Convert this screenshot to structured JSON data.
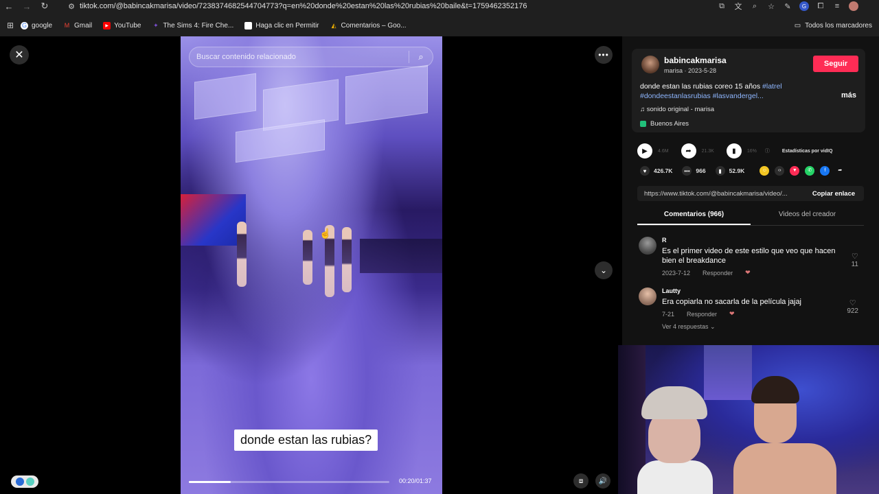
{
  "browser": {
    "url": "tiktok.com/@babincakmarisa/video/7238374682544704773?q=en%20donde%20estan%20las%20rubias%20baile&t=1759462352176",
    "bookmarks": [
      {
        "label": "google",
        "icon": "google-icon",
        "color": "#4285f4"
      },
      {
        "label": "Gmail",
        "icon": "gmail-icon",
        "color": "#ea4335"
      },
      {
        "label": "YouTube",
        "icon": "youtube-icon",
        "color": "#ff0000"
      },
      {
        "label": "The Sims 4: Fire Che...",
        "icon": "sims-icon",
        "color": "#7a4fd0"
      },
      {
        "label": "Haga clic en Permitir",
        "icon": "blank-page-icon",
        "color": "#ffffff"
      },
      {
        "label": "Comentarios – Goo...",
        "icon": "drive-icon",
        "color": "#f4b400"
      }
    ],
    "all_bookmarks": "Todos los marcadores"
  },
  "video": {
    "search_placeholder": "Buscar contenido relacionado",
    "caption": "donde estan las rubias?",
    "time": "00:20/01:37",
    "progress": 0.21
  },
  "post": {
    "username": "babincakmarisa",
    "subline": "marisa · 2023-5-28",
    "follow_label": "Seguir",
    "description_text": "donde estan las rubias coreo 15 años ",
    "tags_line1": "#latrel",
    "tags_line2": "#dondeestanlasrubias #lasvandergel...",
    "more_label": "más",
    "music": "♫  sonido original - marisa",
    "location": "Buenos Aires",
    "views": "4.6M",
    "shares": "21.3K",
    "vidiq_pct": "16%",
    "vidiq_label": "Estadísticas por vidIQ",
    "likes": "426.7K",
    "comments": "966",
    "saves": "52.9K",
    "link": "https://www.tiktok.com/@babincakmarisa/video/...",
    "copy_label": "Copiar enlace"
  },
  "tabs": {
    "comments": "Comentarios (966)",
    "creator_videos": "Videos del creador"
  },
  "comments": [
    {
      "user": "R",
      "text": "Es el primer video de este estilo que veo que hacen bien el breakdance",
      "date": "2023-7-12",
      "reply": "Responder",
      "likes": "11"
    },
    {
      "user": "Lautty",
      "text": "Era copiarla no sacarla de la película jajaj",
      "date": "7-21",
      "reply": "Responder",
      "likes": "922",
      "view_replies": "Ver 4 respuestas ⌄"
    }
  ],
  "colors": {
    "accent": "#fe2c55",
    "tag": "#8fb7ff",
    "panel_bg": "#121212"
  }
}
